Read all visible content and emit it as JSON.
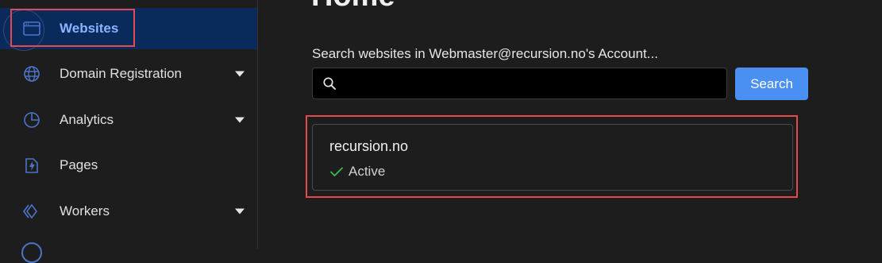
{
  "sidebar": {
    "items": [
      {
        "label": "Websites",
        "icon": "browser-window-icon",
        "active": true,
        "has_caret": false
      },
      {
        "label": "Domain Registration",
        "icon": "globe-icon",
        "active": false,
        "has_caret": true
      },
      {
        "label": "Analytics",
        "icon": "pie-chart-icon",
        "active": false,
        "has_caret": true
      },
      {
        "label": "Pages",
        "icon": "lightning-page-icon",
        "active": false,
        "has_caret": false
      },
      {
        "label": "Workers",
        "icon": "workers-diamond-icon",
        "active": false,
        "has_caret": true
      }
    ]
  },
  "main": {
    "title": "Home",
    "search": {
      "label": "Search websites in Webmaster@recursion.no's Account...",
      "value": "",
      "placeholder": "",
      "button_label": "Search"
    },
    "sites": [
      {
        "name": "recursion.no",
        "status": "Active"
      }
    ]
  },
  "colors": {
    "background": "#1d1d1d",
    "active_nav_bg": "#0b2a5c",
    "active_nav_text": "#8ab4ff",
    "icon_blue": "#4b74c9",
    "accent_button": "#4a90f2",
    "status_ok": "#3fb950",
    "highlight_border": "#e5484d"
  }
}
